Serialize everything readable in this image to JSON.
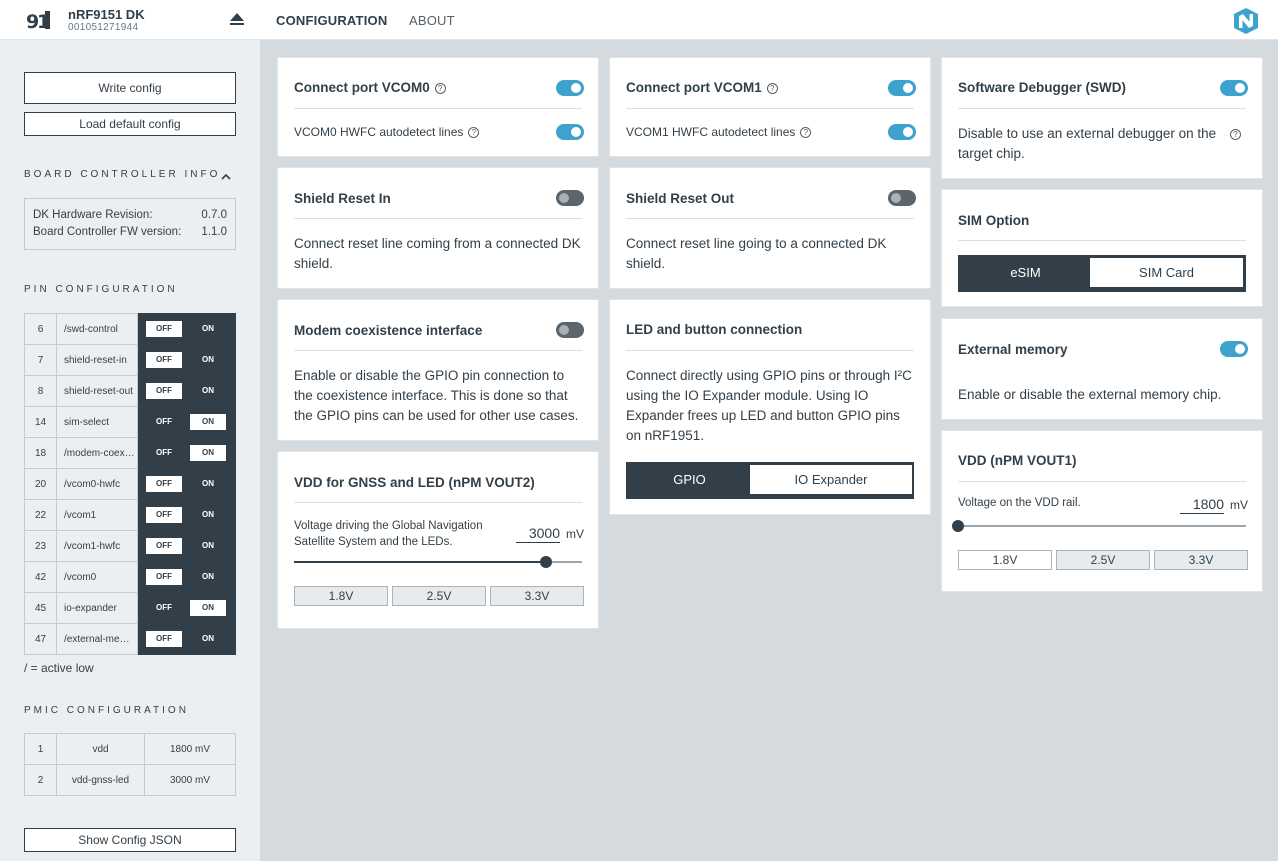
{
  "app": {
    "device_name": "nRF9151 DK",
    "device_serial": "001051271944",
    "tabs": [
      "CONFIGURATION",
      "ABOUT"
    ],
    "accent_color": "#3ea2cf",
    "dark_color": "#333f48"
  },
  "sidebar": {
    "write_config": "Write config",
    "load_default": "Load default config",
    "board_info_title": "BOARD CONTROLLER INFO",
    "board_info": [
      {
        "label": "DK Hardware Revision:",
        "value": "0.7.0"
      },
      {
        "label": "Board Controller FW version:",
        "value": "1.1.0"
      }
    ],
    "pin_config_title": "PIN CONFIGURATION",
    "pins": [
      {
        "num": "6",
        "name": "/swd-control",
        "off": "OFF",
        "on": "ON",
        "state": "off"
      },
      {
        "num": "7",
        "name": "shield-reset-in",
        "off": "OFF",
        "on": "ON",
        "state": "off"
      },
      {
        "num": "8",
        "name": "shield-reset-out",
        "off": "OFF",
        "on": "ON",
        "state": "off"
      },
      {
        "num": "14",
        "name": "sim-select",
        "off": "OFF",
        "on": "ON",
        "state": "on"
      },
      {
        "num": "18",
        "name": "/modem-coex…",
        "off": "OFF",
        "on": "ON",
        "state": "on"
      },
      {
        "num": "20",
        "name": "/vcom0-hwfc",
        "off": "OFF",
        "on": "ON",
        "state": "off"
      },
      {
        "num": "22",
        "name": "/vcom1",
        "off": "OFF",
        "on": "ON",
        "state": "off"
      },
      {
        "num": "23",
        "name": "/vcom1-hwfc",
        "off": "OFF",
        "on": "ON",
        "state": "off"
      },
      {
        "num": "42",
        "name": "/vcom0",
        "off": "OFF",
        "on": "ON",
        "state": "off"
      },
      {
        "num": "45",
        "name": "io-expander",
        "off": "OFF",
        "on": "ON",
        "state": "on"
      },
      {
        "num": "47",
        "name": "/external-me…",
        "off": "OFF",
        "on": "ON",
        "state": "off"
      }
    ],
    "active_low_note": "/ = active low",
    "pmic_title": "PMIC CONFIGURATION",
    "pmic": [
      {
        "num": "1",
        "name": "vdd",
        "value": "1800 mV"
      },
      {
        "num": "2",
        "name": "vdd-gnss-led",
        "value": "3000 mV"
      }
    ],
    "show_json": "Show Config JSON"
  },
  "cards": {
    "vcom0": {
      "title": "Connect port VCOM0",
      "sub": "VCOM0 HWFC autodetect lines",
      "enabled": true,
      "hwfc": true
    },
    "vcom1": {
      "title": "Connect port VCOM1",
      "sub": "VCOM1 HWFC autodetect lines",
      "enabled": true,
      "hwfc": true
    },
    "swd": {
      "title": "Software Debugger (SWD)",
      "desc": "Disable to use an external debugger on the target chip.",
      "enabled": true
    },
    "shield_in": {
      "title": "Shield Reset In",
      "desc": "Connect reset line coming from a connected DK shield.",
      "enabled": false
    },
    "shield_out": {
      "title": "Shield Reset Out",
      "desc": "Connect reset line going to a connected DK shield.",
      "enabled": false
    },
    "sim": {
      "title": "SIM Option",
      "options": [
        "eSIM",
        "SIM Card"
      ],
      "selected": "SIM Card"
    },
    "modem": {
      "title": "Modem coexistence interface",
      "desc": "Enable or disable the GPIO pin connection to the coexistence interface. This is done so that the GPIO pins can be used for other use cases.",
      "enabled": false
    },
    "led": {
      "title": "LED and button connection",
      "desc": "Connect directly using GPIO pins or through I²C using the IO Expander module. Using IO Expander frees up LED and button GPIO pins on nRF1951.",
      "options": [
        "GPIO",
        "IO Expander"
      ],
      "selected": "IO Expander"
    },
    "extmem": {
      "title": "External memory",
      "desc": "Enable or disable the external memory chip.",
      "enabled": true
    },
    "gnss": {
      "title": "VDD for GNSS and LED (nPM VOUT2)",
      "label": "Voltage driving the Global Navigation Satellite System and the LEDs.",
      "value": "3000",
      "unit": "mV",
      "min_mv": 1000,
      "max_mv": 3300,
      "presets": [
        "1.8V",
        "2.5V",
        "3.3V"
      ]
    },
    "vdd": {
      "title": "VDD (nPM VOUT1)",
      "label": "Voltage on the VDD rail.",
      "value": "1800",
      "unit": "mV",
      "min_mv": 1800,
      "max_mv": 3300,
      "presets": [
        "1.8V",
        "2.5V",
        "3.3V"
      ]
    }
  }
}
